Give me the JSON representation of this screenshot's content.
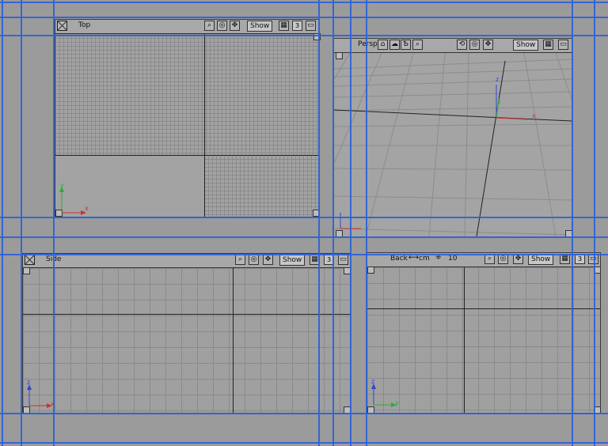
{
  "viewports": {
    "top": {
      "label": "Top",
      "show_label": "Show",
      "num_label": "3"
    },
    "persp": {
      "label": "Persp",
      "show_label": "Show"
    },
    "side": {
      "label": "Side",
      "show_label": "Show",
      "num_label": "3"
    },
    "back": {
      "label": "Back",
      "unit_label": "cm",
      "grid_value": "10",
      "show_label": "Show",
      "num_label": "3"
    }
  },
  "axes": {
    "x": "x",
    "y": "y",
    "z": "z"
  },
  "colors": {
    "guide": "#2f63d6",
    "axis_x": "#d23030",
    "axis_y": "#2faa3a",
    "axis_z": "#2f45d6"
  },
  "icons": [
    "close-icon",
    "zoom-icon",
    "orbit-icon",
    "pan-icon",
    "grid-icon",
    "maximize-icon",
    "camera-icon"
  ]
}
